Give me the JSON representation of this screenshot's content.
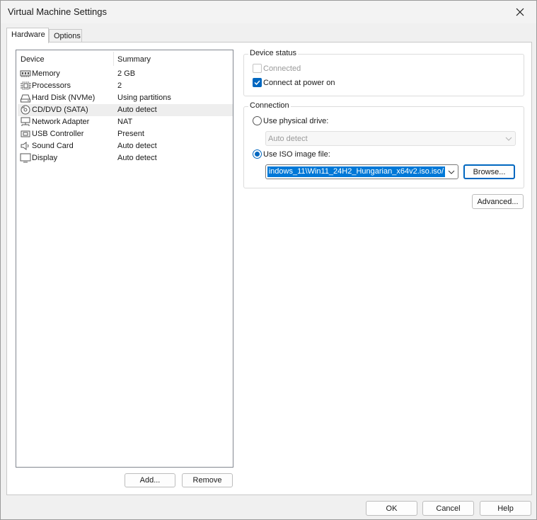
{
  "window": {
    "title": "Virtual Machine Settings"
  },
  "tabs": [
    {
      "label": "Hardware",
      "active": true
    },
    {
      "label": "Options",
      "active": false
    }
  ],
  "device_list": {
    "columns": {
      "device": "Device",
      "summary": "Summary"
    },
    "rows": [
      {
        "name": "Memory",
        "summary": "2 GB",
        "icon": "memory-icon"
      },
      {
        "name": "Processors",
        "summary": "2",
        "icon": "processor-icon"
      },
      {
        "name": "Hard Disk (NVMe)",
        "summary": "Using partitions",
        "icon": "hard-disk-icon"
      },
      {
        "name": "CD/DVD (SATA)",
        "summary": "Auto detect",
        "icon": "cd-dvd-icon",
        "selected": true
      },
      {
        "name": "Network Adapter",
        "summary": "NAT",
        "icon": "network-adapter-icon"
      },
      {
        "name": "USB Controller",
        "summary": "Present",
        "icon": "usb-icon"
      },
      {
        "name": "Sound Card",
        "summary": "Auto detect",
        "icon": "speaker-icon"
      },
      {
        "name": "Display",
        "summary": "Auto detect",
        "icon": "monitor-icon"
      }
    ],
    "add_label": "Add...",
    "remove_label": "Remove"
  },
  "device_status": {
    "title": "Device status",
    "connected_label": "Connected",
    "connected_checked": false,
    "connected_enabled": false,
    "power_on_label": "Connect at power on",
    "power_on_checked": true
  },
  "connection": {
    "title": "Connection",
    "physical_label": "Use physical drive:",
    "physical_selected": false,
    "physical_value": "Auto detect",
    "iso_label": "Use ISO image file:",
    "iso_selected": true,
    "iso_value": "/indows_11\\Win11_24H2_Hungarian_x64v2.iso.iso",
    "browse_label": "Browse..."
  },
  "advanced_label": "Advanced...",
  "footer": {
    "ok_label": "OK",
    "cancel_label": "Cancel",
    "help_label": "Help"
  },
  "colors": {
    "accent": "#0067c0",
    "selection": "#0078d7"
  }
}
